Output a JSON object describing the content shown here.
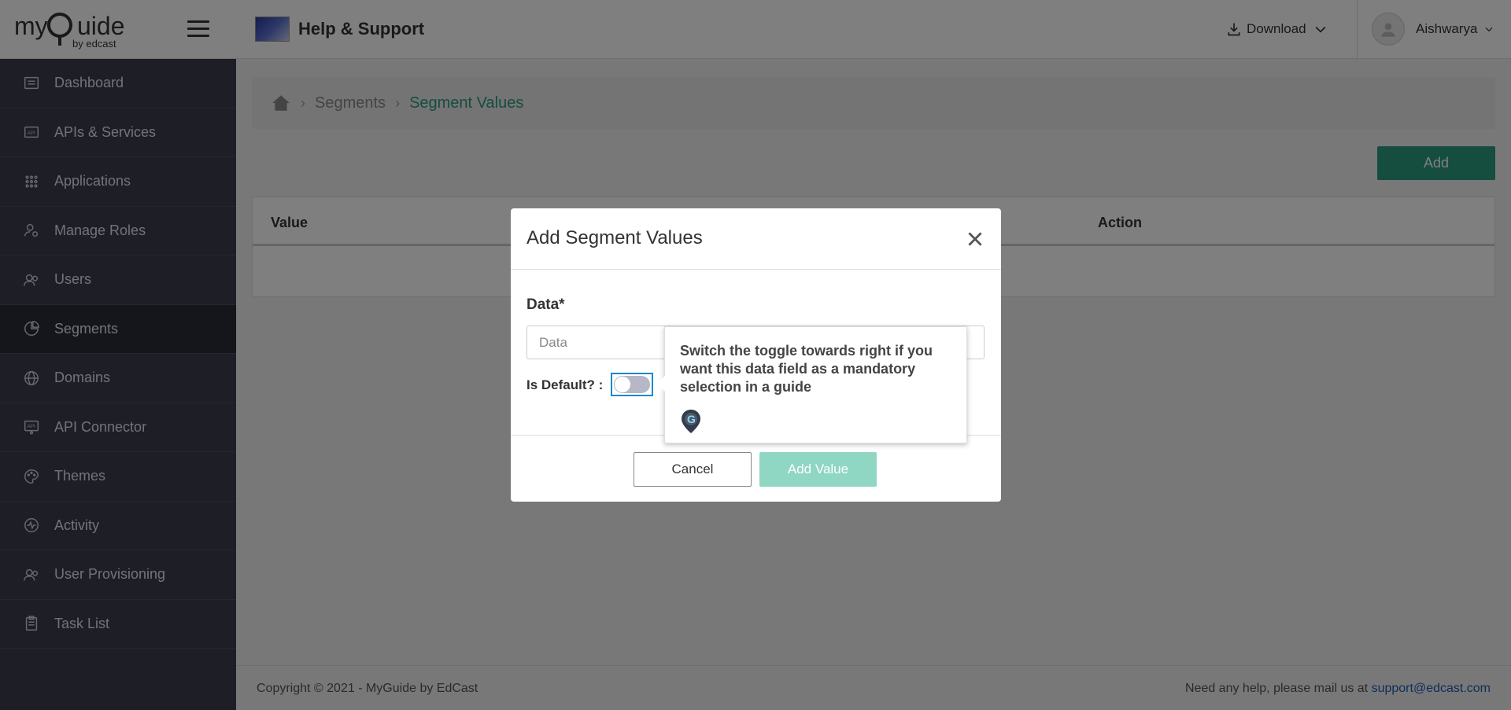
{
  "brand": {
    "logo_text": "myGuide",
    "logo_sub": "by edcast"
  },
  "sidebar": {
    "items": [
      {
        "label": "Dashboard",
        "icon": "dashboard-icon"
      },
      {
        "label": "APIs & Services",
        "icon": "api-icon"
      },
      {
        "label": "Applications",
        "icon": "grid-icon"
      },
      {
        "label": "Manage Roles",
        "icon": "roles-icon"
      },
      {
        "label": "Users",
        "icon": "users-icon"
      },
      {
        "label": "Segments",
        "icon": "pie-icon",
        "active": true
      },
      {
        "label": "Domains",
        "icon": "globe-icon"
      },
      {
        "label": "API Connector",
        "icon": "api-connector-icon"
      },
      {
        "label": "Themes",
        "icon": "palette-icon"
      },
      {
        "label": "Activity",
        "icon": "activity-icon"
      },
      {
        "label": "User Provisioning",
        "icon": "user-provisioning-icon"
      },
      {
        "label": "Task List",
        "icon": "clipboard-icon"
      }
    ]
  },
  "header": {
    "app_title": "Help & Support",
    "download_label": "Download",
    "user_name": "Aishwarya"
  },
  "breadcrumb": {
    "items": [
      "Segments",
      "Segment Values"
    ]
  },
  "main": {
    "add_label": "Add",
    "table": {
      "columns": [
        "Value",
        "Action"
      ]
    }
  },
  "footer": {
    "copyright": "Copyright © 2021 - MyGuide by EdCast",
    "help_text": "Need any help, please mail us at",
    "email": "support@edcast.com"
  },
  "modal": {
    "title": "Add Segment Values",
    "data_label": "Data*",
    "data_placeholder": "Data",
    "data_value": "",
    "default_label": "Is Default? :",
    "default_on": false,
    "cancel_label": "Cancel",
    "add_value_label": "Add Value"
  },
  "tooltip": {
    "text": "Switch the toggle towards right if you want this data field as a mandatory selection in a guide"
  },
  "colors": {
    "sidebar_bg": "#3a3d4c",
    "accent": "#2b9a7e",
    "link": "#1a5fb4",
    "toggle_focus": "#1a8ac8"
  }
}
